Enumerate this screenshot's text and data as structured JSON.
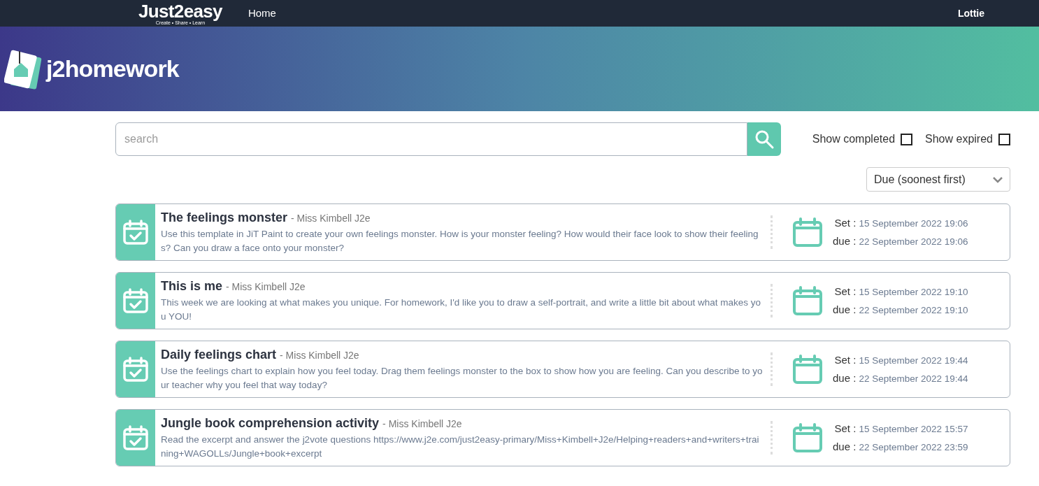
{
  "nav": {
    "brand": "Just2easy",
    "tagline": "Create • Share • Learn",
    "links": [
      "Home"
    ],
    "user": "Lottie"
  },
  "banner": {
    "app_name": "j2homework"
  },
  "search": {
    "placeholder": "search"
  },
  "filters": [
    {
      "label": "Show completed",
      "checked": false
    },
    {
      "label": "Show expired",
      "checked": false
    }
  ],
  "sort": {
    "value": "Due (soonest first)"
  },
  "assignments": [
    {
      "title": "The feelings monster",
      "teacher": "- Miss Kimbell J2e",
      "description": "Use this template in JiT Paint to create your own feelings monster. How is your monster feeling? How would their face look to show their feelings? Can you draw a face onto your monster?",
      "set_label": "Set :",
      "set_date": "15 September 2022 19:06",
      "due_label": "due :",
      "due_date": "22 September 2022 19:06"
    },
    {
      "title": "This is me",
      "teacher": "- Miss Kimbell J2e",
      "description": "This week we are looking at what makes you unique. For homework, I'd like you to draw a self-portrait, and write a little bit about what makes you YOU!",
      "set_label": "Set :",
      "set_date": "15 September 2022 19:10",
      "due_label": "due :",
      "due_date": "22 September 2022 19:10"
    },
    {
      "title": "Daily feelings chart",
      "teacher": "- Miss Kimbell J2e",
      "description": "Use the feelings chart to explain how you feel today. Drag them feelings monster to the box to show how you are feeling. Can you describe to your teacher why you feel that way today?",
      "set_label": "Set :",
      "set_date": "15 September 2022 19:44",
      "due_label": "due :",
      "due_date": "22 September 2022 19:44"
    },
    {
      "title": "Jungle book comprehension activity",
      "teacher": "- Miss Kimbell J2e",
      "description": "Read the excerpt and answer the j2vote questions https://www.j2e.com/just2easy-primary/Miss+Kimbell+J2e/Helping+readers+and+writers+training+WAGOLLs/Jungle+book+excerpt",
      "set_label": "Set :",
      "set_date": "15 September 2022 15:57",
      "due_label": "due :",
      "due_date": "22 September 2022 23:59"
    }
  ]
}
